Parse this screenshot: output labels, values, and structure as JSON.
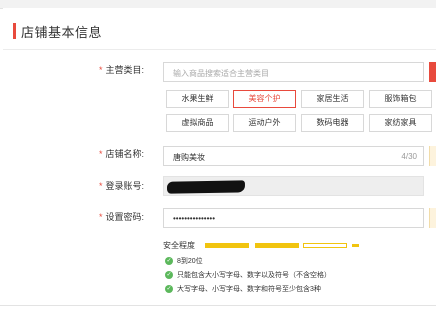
{
  "section": {
    "title": "店铺基本信息"
  },
  "fields": {
    "main_category": {
      "label": "主营类目:",
      "placeholder": "输入商品搜索适合主营类目",
      "options": [
        "水果生鲜",
        "美容个护",
        "家居生活",
        "服饰箱包",
        "虚拟商品",
        "运动户外",
        "数码电器",
        "家纺家具"
      ],
      "selected": "美容个护"
    },
    "store_name": {
      "label": "店铺名称:",
      "value": "唐购美妆",
      "counter": "4/30"
    },
    "login_account": {
      "label": "登录账号:",
      "value": ""
    },
    "password": {
      "label": "设置密码:",
      "value": "•••••••••••••••"
    }
  },
  "password_strength": {
    "label": "安全程度",
    "level_filled": 2,
    "level_total": 3,
    "rules": [
      "8到20位",
      "只能包含大小写字母、数字以及符号（不含空格）",
      "大写字母、小写字母、数字和符号至少包含3种"
    ]
  },
  "colors": {
    "accent": "#e84a3d",
    "strength": "#f1c40f",
    "check": "#5cb85c"
  }
}
